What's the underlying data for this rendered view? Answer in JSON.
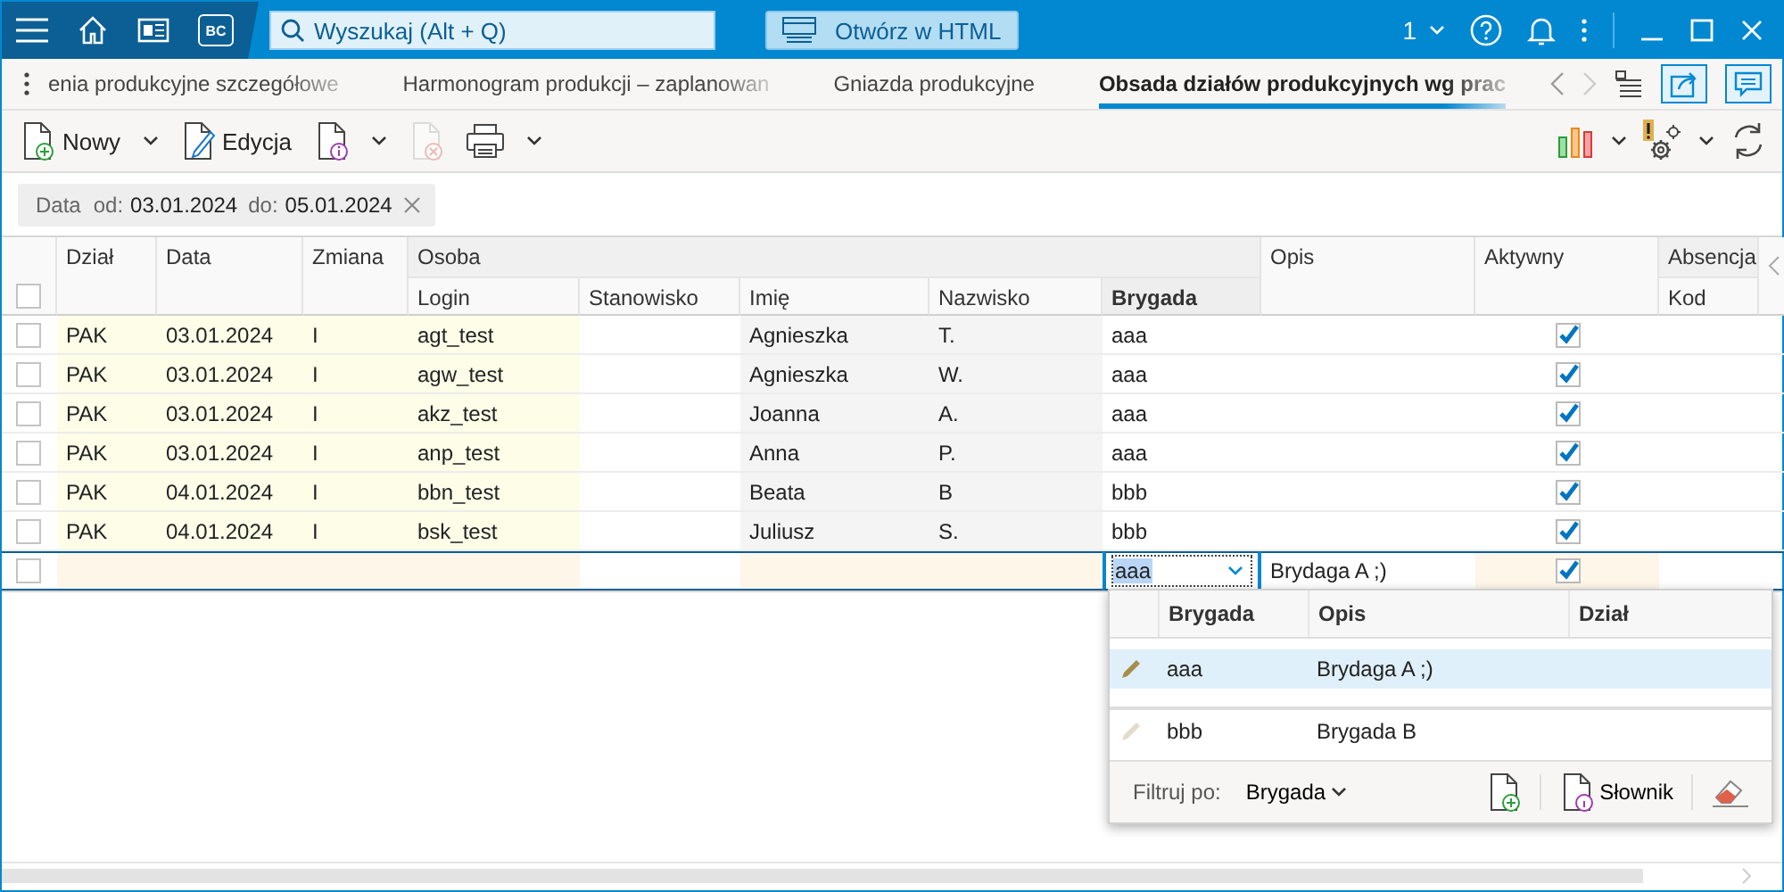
{
  "titlebar": {
    "badge": "BC",
    "search_placeholder": "Wyszukaj (Alt + Q)",
    "open_html_button": "Otwórz w HTML",
    "company": "1"
  },
  "tabs": [
    {
      "label": "enia produkcyjne szczegółowe",
      "selected": false
    },
    {
      "label": "Harmonogram produkcji – zaplanowan",
      "selected": false
    },
    {
      "label": "Gniazda produkcyjne",
      "selected": false
    },
    {
      "label": "Obsada działów produkcyjnych wg prac",
      "selected": true
    }
  ],
  "toolbar": [
    {
      "kind": "new",
      "label": "Nowy",
      "dropdown": true,
      "disabled": false
    },
    {
      "kind": "edit",
      "label": "Edycja",
      "dropdown": false,
      "disabled": false
    },
    {
      "kind": "info",
      "dropdown": true,
      "disabled": false
    },
    {
      "kind": "delete",
      "dropdown": false,
      "disabled": true
    },
    {
      "kind": "print",
      "dropdown": true,
      "disabled": false
    }
  ],
  "filter": {
    "label": "Data",
    "from_label": "od:",
    "from": "03.01.2024",
    "to_label": "do:",
    "to": "05.01.2024"
  },
  "grid": {
    "select_all": false,
    "columns": [
      {
        "label": "Dział",
        "kind": "key",
        "active": false
      },
      {
        "label": "Data",
        "kind": "key",
        "active": false
      },
      {
        "label": "Zmiana",
        "kind": "key",
        "active": false
      },
      {
        "label": "Login",
        "group": "Osoba",
        "kind": "key",
        "active": false
      },
      {
        "label": "Stanowisko",
        "sub": true,
        "kind": "editable",
        "active": false
      },
      {
        "label": "Imię",
        "sub": true,
        "kind": "readonly",
        "active": false
      },
      {
        "label": "Nazwisko",
        "sub": true,
        "kind": "readonly",
        "active": false
      },
      {
        "label": "Brygada",
        "sub": true,
        "kind": "lookup",
        "active": true
      },
      {
        "label": "Opis",
        "sub": false,
        "kind": "editable",
        "active": false
      },
      {
        "label": "Aktywny",
        "sub": false,
        "kind": "check",
        "active": false
      },
      {
        "label": "Kod",
        "group": "Absencja",
        "kind": "editable",
        "active": false
      }
    ],
    "rows": [
      {
        "kind": "data",
        "selected": false,
        "cells": [
          "PAK",
          "03.01.2024",
          "I",
          "agt_test",
          null,
          "Agnieszka",
          "T.",
          "aaa",
          null,
          true,
          null
        ]
      },
      {
        "kind": "data",
        "selected": false,
        "cells": [
          "PAK",
          "03.01.2024",
          "I",
          "agw_test",
          null,
          "Agnieszka",
          "W.",
          "aaa",
          null,
          true,
          null
        ]
      },
      {
        "kind": "data",
        "selected": false,
        "cells": [
          "PAK",
          "03.01.2024",
          "I",
          "akz_test",
          null,
          "Joanna",
          "A.",
          "aaa",
          null,
          true,
          null
        ]
      },
      {
        "kind": "data",
        "selected": false,
        "cells": [
          "PAK",
          "03.01.2024",
          "I",
          "anp_test",
          null,
          "Anna",
          "P.",
          "aaa",
          null,
          true,
          null
        ]
      },
      {
        "kind": "data",
        "selected": false,
        "cells": [
          "PAK",
          "04.01.2024",
          "I",
          "bbn_test",
          null,
          "Beata",
          "B",
          "bbb",
          null,
          true,
          null
        ]
      },
      {
        "kind": "data",
        "selected": false,
        "cells": [
          "PAK",
          "04.01.2024",
          "I",
          "bsk_test",
          null,
          "Juliusz",
          "S.",
          "bbb",
          null,
          true,
          null
        ]
      },
      {
        "kind": "new",
        "selected": false,
        "cells": [
          null,
          null,
          null,
          null,
          null,
          null,
          null,
          "aaa",
          "Brydaga A ;)",
          true,
          null
        ]
      }
    ]
  },
  "lookup": {
    "columns": [
      "Brygada",
      "Opis",
      "Dział"
    ],
    "items": [
      {
        "selected": true,
        "cells": [
          "aaa",
          "Brydaga A ;)"
        ]
      },
      {
        "selected": false,
        "cells": [
          "bbb",
          "Brygada B"
        ]
      }
    ],
    "filter_label": "Filtruj po:",
    "filter_value": "Brygada",
    "dictionary_button": "Słownik"
  }
}
